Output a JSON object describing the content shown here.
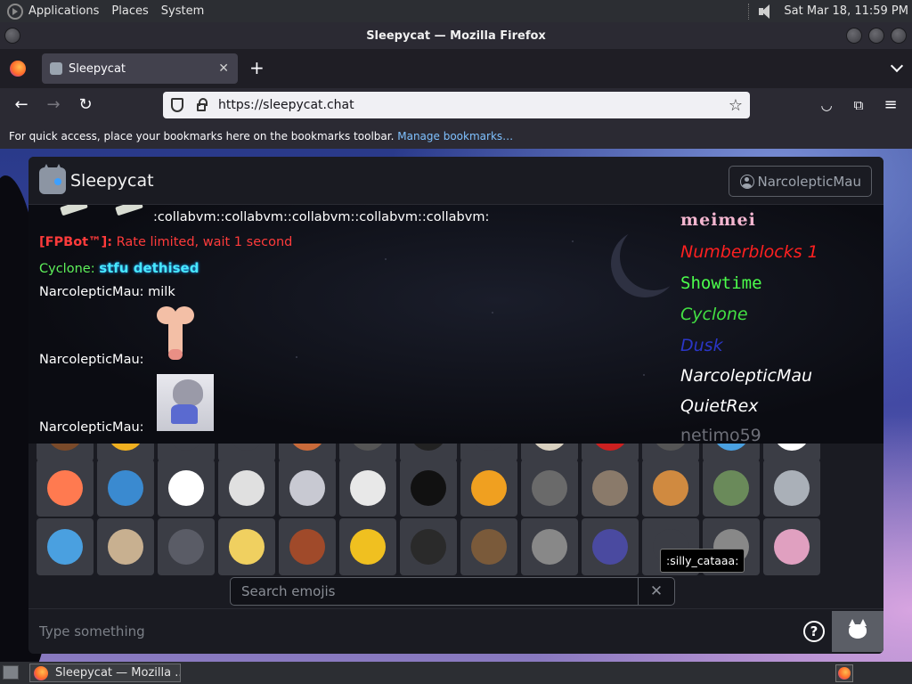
{
  "top_panel": {
    "menu_items": [
      "Applications",
      "Places",
      "System"
    ],
    "clock": "Sat Mar 18, 11:59 PM"
  },
  "window": {
    "title": "Sleepycat — Mozilla Firefox"
  },
  "browser": {
    "tab_title": "Sleepycat",
    "url": "https://sleepycat.chat",
    "bookmarks_text": "For quick access, place your bookmarks here on the bookmarks toolbar.",
    "bookmarks_link": "Manage bookmarks…"
  },
  "chat": {
    "brand": "Sleepycat",
    "user_button": "NarcolepticMau",
    "messages": [
      {
        "text": ":collabvm::collabvm::collabvm::collabvm::collabvm:"
      },
      {
        "user": "[FPBot™]:",
        "text": "Rate limited, wait 1 second"
      },
      {
        "user": "Cyclone:",
        "text": "stfu dethised"
      },
      {
        "user": "NarcolepticMau:",
        "text": "milk"
      },
      {
        "user": "NarcolepticMau:",
        "text": ""
      },
      {
        "user": "NarcolepticMau:",
        "text": ""
      }
    ],
    "users": [
      "meimei",
      "Numberblocks 1",
      "Showtime",
      "Cyclone",
      "Dusk",
      "NarcolepticMau",
      "QuietRex",
      "netimo59"
    ],
    "emoji_tooltip": ":silly_cataaa:",
    "emoji_search_placeholder": "Search emojis",
    "emoji_clear": "✕",
    "input_placeholder": "Type something",
    "help_label": "?"
  },
  "taskbar": {
    "task_label": "Sleepycat — Mozilla ..."
  },
  "colors": {
    "bot_red": "#ff3b3b",
    "cyclone_green": "#5ef05a",
    "accent_cyan": "#48e8ff"
  }
}
